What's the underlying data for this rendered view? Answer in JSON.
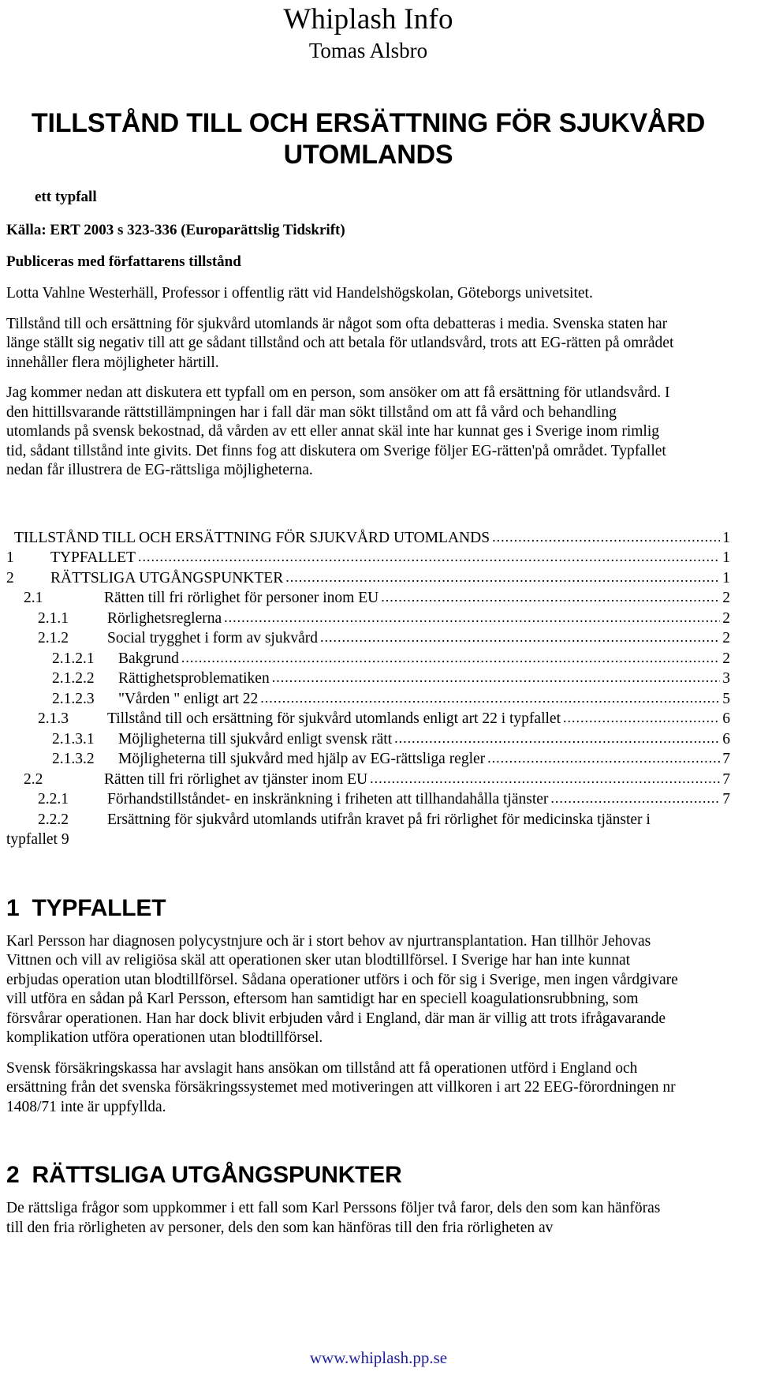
{
  "masthead": {
    "site_title": "Whiplash Info",
    "author_name": "Tomas Alsbro"
  },
  "document": {
    "title": "TILLSTÅND TILL OCH ERSÄTTNING FÖR SJUKVÅRD UTOMLANDS",
    "subtitle": "ett typfall",
    "source_line": "Källa: ERT 2003 s 323-336 (Europarättslig Tidskrift)",
    "permission_line": "Publiceras med författarens tillstånd",
    "byline": "Lotta Vahlne Westerhäll, Professor i offentlig rätt vid Handelshögskolan, Göteborgs univetsitet.",
    "intro_paragraphs": [
      "Tillstånd till och ersättning för sjukvård utomlands är något som ofta debatteras i media. Svenska staten har länge ställt sig negativ till att ge sådant tillstånd och att betala för utlandsvård, trots att EG-rätten på området innehåller flera möjligheter härtill.",
      "Jag kommer nedan att diskutera ett typfall om en person, som ansöker om att få ersättning för utlandsvård. I den hittillsvarande rättstillämpningen har i fall där man sökt tillstånd om att få vård och behandling utomlands på svensk bekostnad, då vården av ett eller annat skäl inte har kunnat ges i Sverige inom rimlig tid, sådant tillstånd inte givits. Det finns fog att diskutera om Sverige följer EG-rätten'på området. Typfallet nedan får illustrera de EG-rättsliga möjligheterna."
    ]
  },
  "toc": {
    "entries": [
      {
        "level": 0,
        "number": "",
        "label": "TILLSTÅND TILL OCH ERSÄTTNING FÖR SJUKVÅRD UTOMLANDS",
        "page": "1"
      },
      {
        "level": 1,
        "number": "1",
        "label": "TYPFALLET",
        "page": "1"
      },
      {
        "level": 1,
        "number": "2",
        "label": "RÄTTSLIGA UTGÅNGSPUNKTER",
        "page": "1"
      },
      {
        "level": 2,
        "number": "2.1",
        "label": "Rätten till fri rörlighet för personer inom EU",
        "page": "2"
      },
      {
        "level": 3,
        "number": "2.1.1",
        "label": "Rörlighetsreglerna",
        "page": "2"
      },
      {
        "level": 3,
        "number": "2.1.2",
        "label": "Social trygghet i form av sjukvård",
        "page": "2"
      },
      {
        "level": 4,
        "number": "2.1.2.1",
        "label": "Bakgrund",
        "page": "2"
      },
      {
        "level": 4,
        "number": "2.1.2.2",
        "label": "Rättighetsproblematiken ",
        "page": "3"
      },
      {
        "level": 4,
        "number": "2.1.2.3",
        "label": "\"Vården \" enligt art 22",
        "page": "5"
      },
      {
        "level": 3,
        "number": "2.1.3",
        "label": "Tillstånd till och ersättning för sjukvård utomlands enligt art 22 i typfallet",
        "page": "6"
      },
      {
        "level": 4,
        "number": "2.1.3.1",
        "label": "Möjligheterna till sjukvård enligt svensk rätt",
        "page": "6"
      },
      {
        "level": 4,
        "number": "2.1.3.2",
        "label": "Möjligheterna till sjukvård med hjälp av EG-rättsliga regler",
        "page": "7"
      },
      {
        "level": 2,
        "number": "2.2",
        "label": "Rätten till fri rörlighet av tjänster inom EU",
        "page": "7"
      },
      {
        "level": 3,
        "number": "2.2.1",
        "label": "Förhandstillståndet- en inskränkning i friheten att tillhandahålla tjänster ",
        "page": "7"
      }
    ],
    "last_entry": {
      "level": 3,
      "number": "2.2.2",
      "label": "Ersättning för sjukvård utomlands utifrån kravet på fri rörlighet för medicinska tjänster i",
      "wrap_text": "typfallet  9"
    }
  },
  "sections": [
    {
      "number": "1",
      "heading": "TYPFALLET",
      "paragraphs": [
        "Karl Persson har diagnosen polycystnjure och är i stort behov av njurtransplantation. Han tillhör Jehovas Vittnen och vill av religiösa skäl att operationen sker utan blodtillförsel. I Sverige har han inte kunnat erbjudas operation utan blodtillförsel. Sådana operationer utförs i och för sig i Sverige, men ingen vårdgivare vill utföra en sådan på Karl Persson, eftersom han samtidigt har en speciell koagulationsrubbning, som försvårar operationen. Han har dock blivit erbjuden vård i England, där man är villig att trots ifrågavarande komplikation utföra operationen utan blodtillförsel.",
        "Svensk försäkringskassa har avslagit hans ansökan om tillstånd att få operationen utförd i England och ersättning från det svenska försäkringssystemet med motiveringen att villkoren i art 22 EEG-förordningen nr 1408/71 inte är uppfyllda."
      ]
    },
    {
      "number": "2",
      "heading": "RÄTTSLIGA UTGÅNGSPUNKTER",
      "paragraphs": [
        "De rättsliga frågor som uppkommer i ett fall som Karl Perssons följer två faror, dels den som kan hänföras till den fria rörligheten av personer, dels den som kan hänföras till den fria rörligheten av"
      ]
    }
  ],
  "footer": {
    "url": "www.whiplash.pp.se"
  },
  "colors": {
    "link": "#22209c",
    "text": "#000000",
    "background": "#ffffff"
  }
}
